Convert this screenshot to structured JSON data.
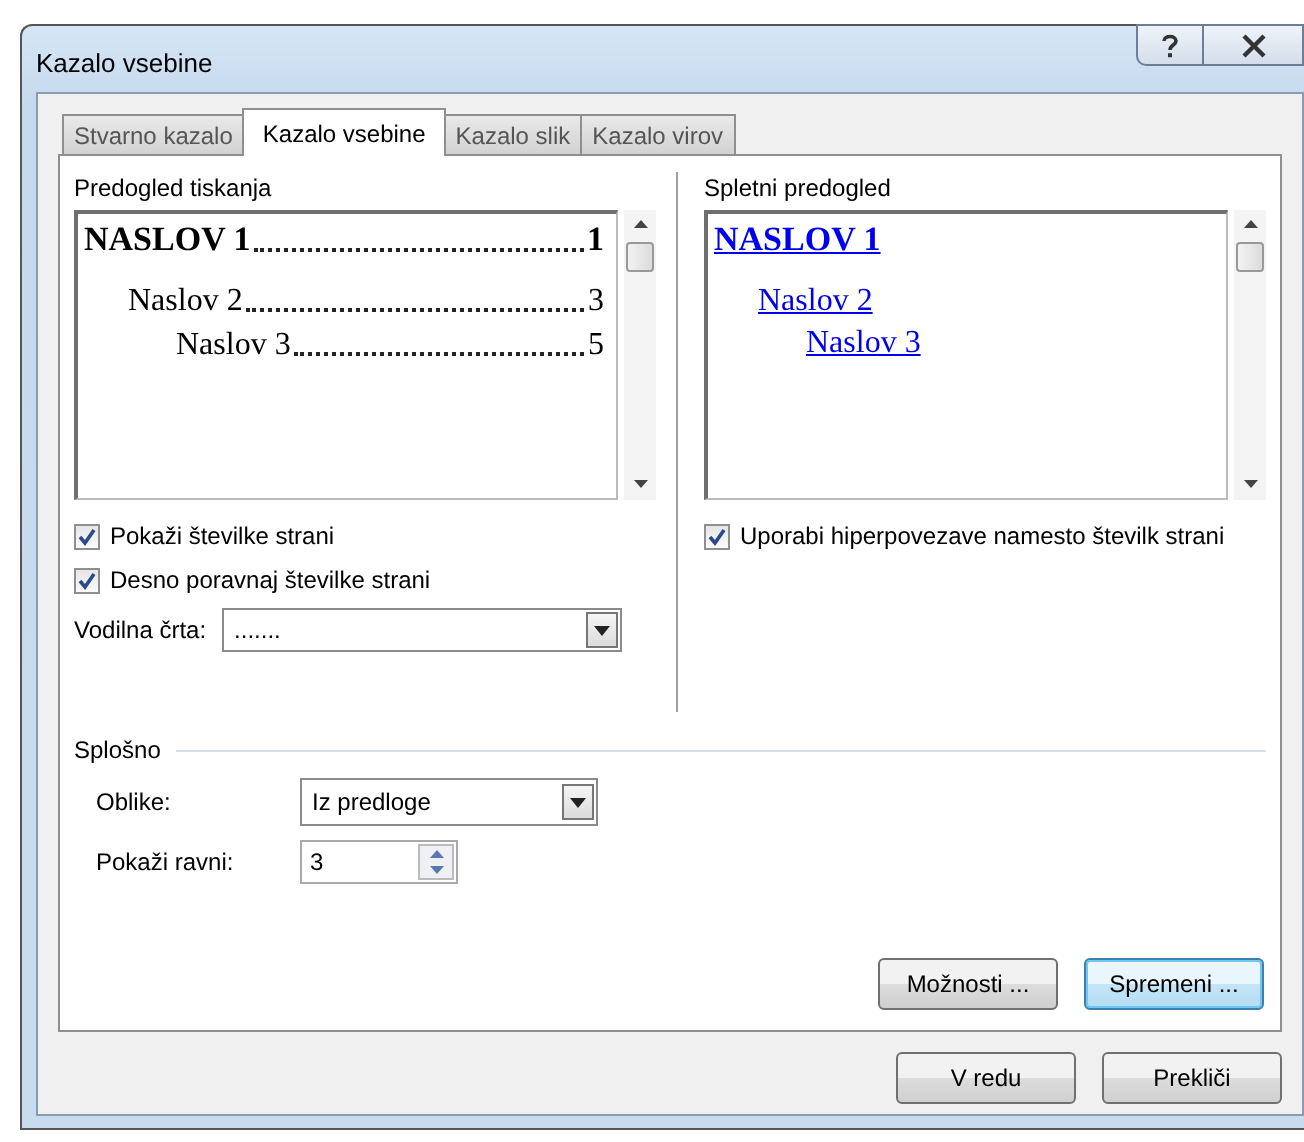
{
  "window": {
    "title": "Kazalo vsebine"
  },
  "tabs": [
    {
      "label": "Stvarno kazalo",
      "selected": false
    },
    {
      "label": "Kazalo vsebine",
      "selected": true
    },
    {
      "label": "Kazalo slik",
      "selected": false
    },
    {
      "label": "Kazalo virov",
      "selected": false
    }
  ],
  "print_preview": {
    "label": "Predogled tiskanja",
    "entries": [
      {
        "text": "NASLOV 1",
        "page": "1",
        "children": [
          {
            "text": "Naslov 2",
            "page": "3",
            "children": [
              {
                "text": "Naslov 3",
                "page": "5"
              }
            ]
          }
        ]
      }
    ]
  },
  "print_options": [
    {
      "label": "Pokaži številke strani",
      "checked": true
    },
    {
      "label": "Desno poravnaj številke strani",
      "checked": true
    }
  ],
  "leader": {
    "label": "Vodilna črta:",
    "value": "......."
  },
  "web_preview": {
    "label": "Spletni predogled",
    "entries": [
      {
        "text": "NASLOV 1",
        "children": [
          {
            "text": "Naslov 2",
            "children": [
              {
                "text": "Naslov 3"
              }
            ]
          }
        ]
      }
    ]
  },
  "web_options": [
    {
      "label": "Uporabi hiperpovezave namesto številk strani",
      "checked": true
    }
  ],
  "general": {
    "label": "Splošno",
    "formats": {
      "label": "Oblike:",
      "value": "Iz predloge"
    },
    "levels": {
      "label": "Pokaži ravni:",
      "value": "3"
    }
  },
  "panel_buttons": [
    {
      "label": "Možnosti ...",
      "default": false
    },
    {
      "label": "Spremeni ...",
      "default": true
    }
  ],
  "dialog_buttons": [
    {
      "label": "V redu",
      "default": false
    },
    {
      "label": "Prekliči",
      "default": false
    }
  ]
}
